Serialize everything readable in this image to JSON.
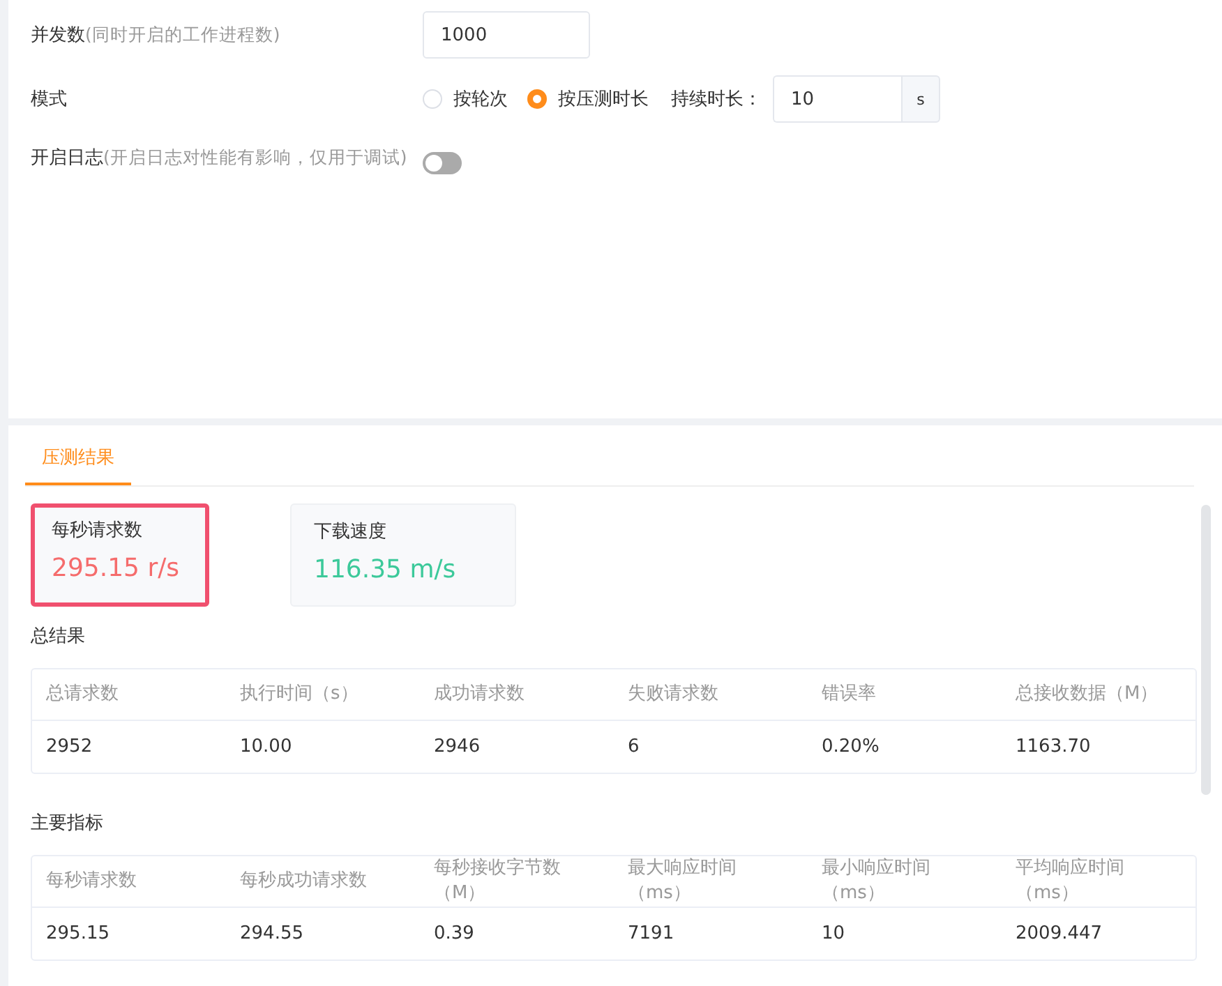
{
  "settings": [
    {
      "kind": "input",
      "label": "并发数",
      "hint": "(同时开启的工作进程数)",
      "value": "1000"
    },
    {
      "kind": "mode",
      "label": "模式",
      "options": [
        {
          "label": "按轮次",
          "selected": false
        },
        {
          "label": "按压测时长",
          "selected": true
        }
      ],
      "duration_label": "持续时长：",
      "duration_value": "10",
      "duration_unit": "s"
    },
    {
      "kind": "switch",
      "label": "开启日志",
      "hint": "(开启日志对性能有影响，仅用于调试)",
      "on": false
    }
  ],
  "tabs": [
    {
      "label": "压测结果",
      "selected": true
    }
  ],
  "stats": [
    {
      "label": "每秒请求数",
      "value": "295.15 r/s",
      "color": "#f56c6c",
      "highlighted": true
    },
    {
      "label": "下载速度",
      "value": "116.35 m/s",
      "color": "#3cc99a",
      "highlighted": false
    }
  ],
  "tables": [
    {
      "title": "总结果",
      "columns": [
        "总请求数",
        "执行时间（s）",
        "成功请求数",
        "失败请求数",
        "错误率",
        "总接收数据（M）"
      ],
      "rows": [
        [
          "2952",
          "10.00",
          "2946",
          "6",
          "0.20%",
          "1163.70"
        ]
      ]
    },
    {
      "title": "主要指标",
      "columns": [
        "每秒请求数",
        "每秒成功请求数",
        "每秒接收字节数（M）",
        "最大响应时间（ms）",
        "最小响应时间（ms）",
        "平均响应时间（ms）"
      ],
      "rows": [
        [
          "295.15",
          "294.55",
          "0.39",
          "7191",
          "10",
          "2009.447"
        ]
      ]
    }
  ]
}
